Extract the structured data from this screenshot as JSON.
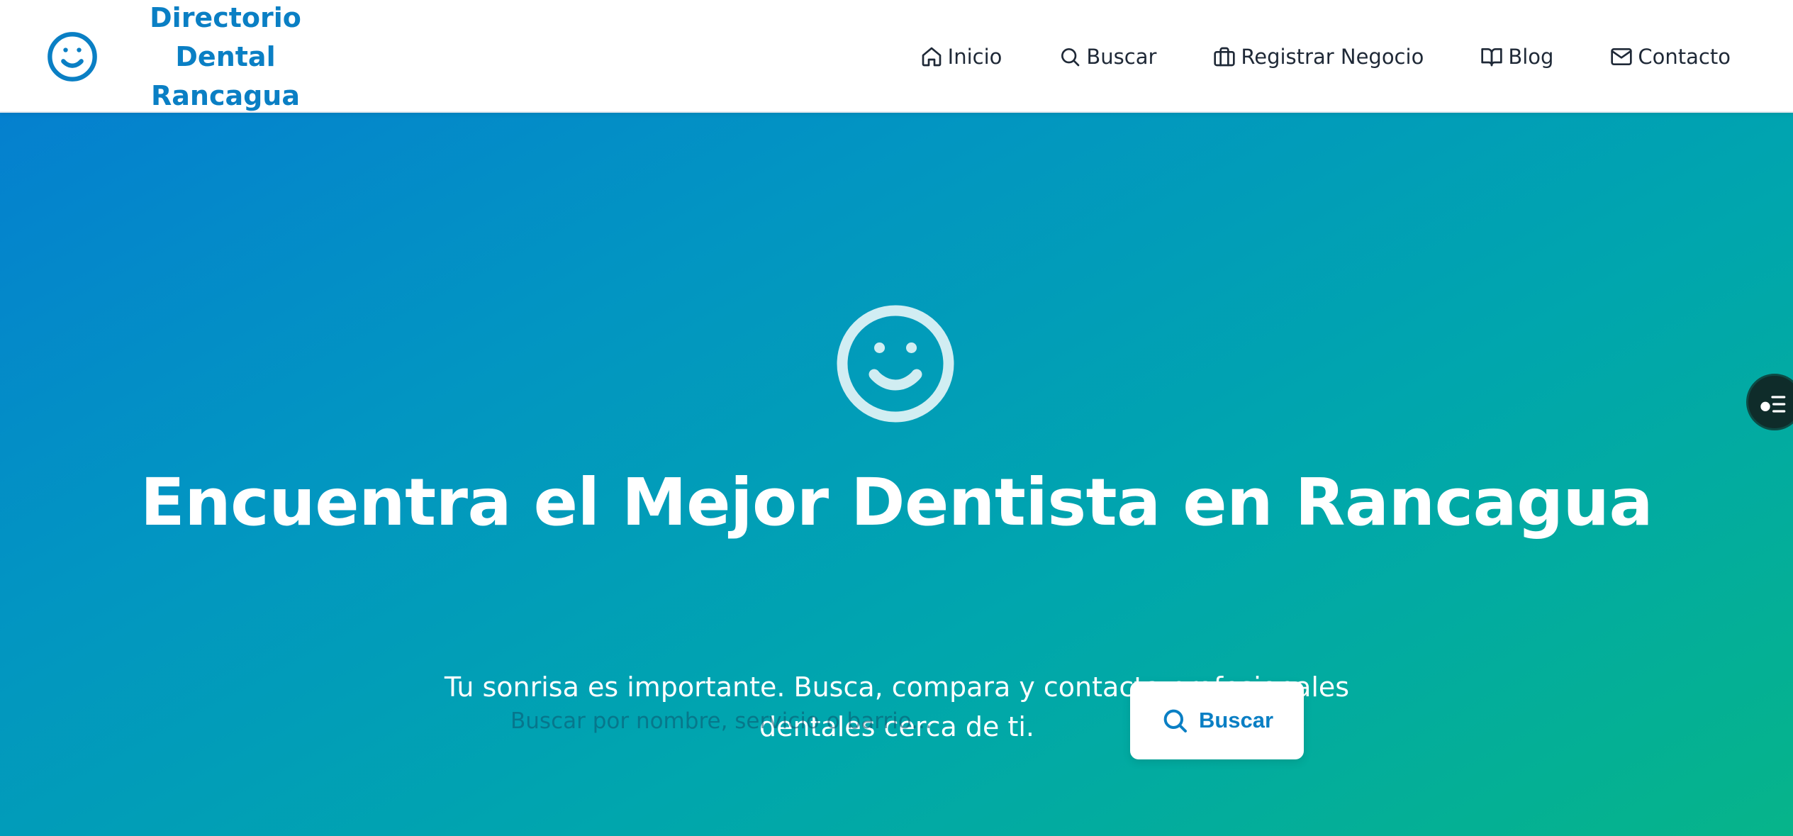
{
  "header": {
    "brand_name": "Directorio Dental Rancagua",
    "brand_icon": "smile-icon",
    "nav": [
      {
        "label": "Inicio",
        "icon": "home-icon"
      },
      {
        "label": "Buscar",
        "icon": "search-icon"
      },
      {
        "label": "Registrar Negocio",
        "icon": "briefcase-icon"
      },
      {
        "label": "Blog",
        "icon": "book-open-icon"
      },
      {
        "label": "Contacto",
        "icon": "mail-icon"
      }
    ]
  },
  "hero": {
    "icon": "smile-icon",
    "title": "Encuentra el Mejor Dentista en Rancagua",
    "subtitle": "Tu sonrisa es importante. Busca, compara y contacta profesionales dentales cerca de ti.",
    "search": {
      "placeholder": "Buscar por nombre, servicio o barrio...",
      "value": "",
      "button_label": "Buscar",
      "button_icon": "search-icon"
    }
  },
  "floating_button": {
    "icon": "accessibility-menu-icon"
  },
  "colors": {
    "brand": "#0a7fc4",
    "hero_gradient_start": "#0580cf",
    "hero_gradient_end": "#06b48a",
    "nav_text": "#1f2937"
  }
}
